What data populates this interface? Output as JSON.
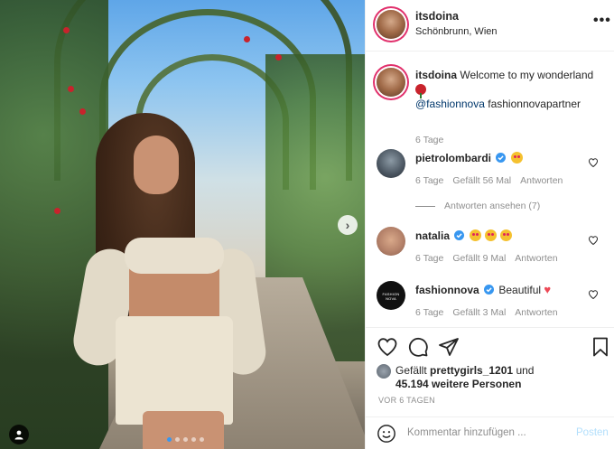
{
  "post": {
    "username": "itsdoina",
    "location": "Schönbrunn, Wien",
    "caption": "Welcome to my wonderland",
    "mention": "@fashionnova",
    "caption_tag": "fashionnovapartner",
    "caption_age": "6 Tage"
  },
  "comments": [
    {
      "user": "pietrolombardi",
      "verified": true,
      "text": "",
      "age": "6 Tage",
      "likes": "Gefällt 56 Mal",
      "reply": "Antworten",
      "view_replies": "Antworten ansehen (7)"
    },
    {
      "user": "natalia",
      "verified": true,
      "text": "",
      "age": "6 Tage",
      "likes": "Gefällt 9 Mal",
      "reply": "Antworten"
    },
    {
      "user": "fashionnova",
      "verified": true,
      "text": "Beautiful",
      "age": "6 Tage",
      "likes": "Gefällt 3 Mal",
      "reply": "Antworten"
    }
  ],
  "likes": {
    "prefix": "Gefällt",
    "first_user": "prettygirls_1201",
    "joiner": "und",
    "others": "45.194 weitere Personen"
  },
  "timestamp": "VOR 6 TAGEN",
  "comment_box": {
    "placeholder": "Kommentar hinzufügen ...",
    "post_label": "Posten"
  },
  "carousel": {
    "slides": 5,
    "active_index": 0
  },
  "colors": {
    "verified": "#3897f0",
    "link": "#00376b",
    "muted": "#8e8e8e",
    "post_disabled": "#b2dffc",
    "like_red": "#ed4956"
  }
}
